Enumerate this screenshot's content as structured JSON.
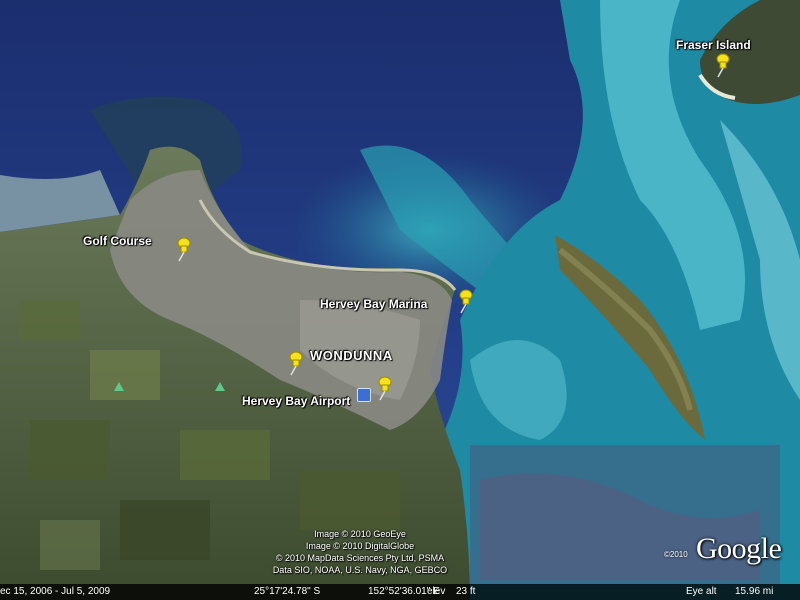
{
  "map": {
    "labels": {
      "fraser_island": "Fraser Island",
      "golf_course": "Golf Course",
      "hervey_bay_marina": "Hervey Bay Marina",
      "wondunna": "WONDUNNA",
      "hervey_bay_airport": "Hervey Bay Airport"
    },
    "credits": [
      "Image © 2010 GeoEye",
      "Image © 2010 DigitalGlobe",
      "© 2010 MapData Sciences Pty Ltd, PSMA",
      "Data SIO, NOAA, U.S. Navy, NGA, GEBCO"
    ],
    "logo": {
      "copyright": "©2010",
      "text": "Google"
    },
    "status": {
      "date_range": "ec 15, 2006 - Jul 5, 2009",
      "latitude": "25°17'24.78\" S",
      "longitude": "152°52'36.01\" E",
      "elev_label": "elev",
      "elev_value": "23 ft",
      "eye_alt_label": "Eye alt",
      "eye_alt_value": "15.96 mi"
    },
    "icons": {
      "placemark": "yellow-pushpin-icon",
      "airport": "airport-icon",
      "peak": "mountain-peak-icon"
    },
    "colors": {
      "deep_sea": "#1d3374",
      "shallow_water": "#1c8aa0",
      "land": "#4a5a3a",
      "urban": "#8a8a86",
      "pin_yellow": "#f5e21a",
      "peak_green": "#5ec88a"
    }
  }
}
